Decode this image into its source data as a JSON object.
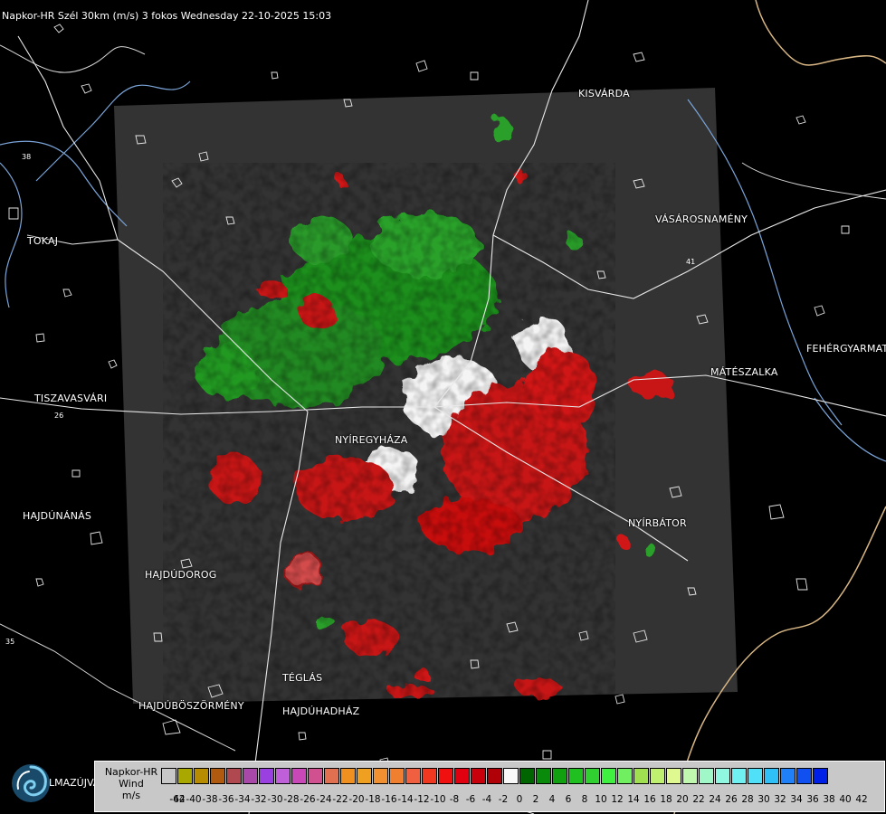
{
  "title": "Napkor-HR Szél 30km (m/s) 3 fokos Wednesday 22-10-2025 15:03",
  "cities": [
    {
      "name": "KISVÁRDA"
    },
    {
      "name": "VÁSÁROSNAMÉNY"
    },
    {
      "name": "TOKAJ"
    },
    {
      "name": "FEHÉRGYARMAT"
    },
    {
      "name": "MÁTÉSZALKA"
    },
    {
      "name": "TISZAVASVÁRI"
    },
    {
      "name": "NYÍREGYHÁZA"
    },
    {
      "name": "NYÍRBÁTOR"
    },
    {
      "name": "HAJDÚNÁNÁS"
    },
    {
      "name": "HAJDÚDOROG"
    },
    {
      "name": "TÉGLÁS"
    },
    {
      "name": "HAJDÚBÖSZÖRMÉNY"
    },
    {
      "name": "HAJDÚHADHÁZ"
    }
  ],
  "road_labels": [
    "38",
    "35",
    "26",
    "41"
  ],
  "logo": {
    "icon": "swirl-icon",
    "text": "LMAZÚJVÁR"
  },
  "legend": {
    "line1": "Napkor-HR",
    "line2": "Wind",
    "line3": "m/s",
    "ticks": [
      "-64",
      "-42",
      "-40",
      "-38",
      "-36",
      "-34",
      "-32",
      "-30",
      "-28",
      "-26",
      "-24",
      "-22",
      "-20",
      "-18",
      "-16",
      "-14",
      "-12",
      "-10",
      "-8",
      "-6",
      "-4",
      "-2",
      "0",
      "2",
      "4",
      "6",
      "8",
      "10",
      "12",
      "14",
      "16",
      "18",
      "20",
      "22",
      "24",
      "26",
      "28",
      "30",
      "32",
      "34",
      "36",
      "38",
      "40",
      "42"
    ],
    "colors": [
      "#c8c8c8",
      "#a8a800",
      "#b88c00",
      "#b05a10",
      "#b04850",
      "#a848a8",
      "#9a40e0",
      "#c060d8",
      "#c848b8",
      "#d05090",
      "#e07050",
      "#f09020",
      "#f0a020",
      "#f09030",
      "#f08030",
      "#f06040",
      "#f03820",
      "#f01010",
      "#e00010",
      "#c8000c",
      "#b00008",
      "#f8f8f8",
      "#006400",
      "#0a8a0a",
      "#10a010",
      "#20c020",
      "#30d030",
      "#40f040",
      "#70f060",
      "#a0e050",
      "#c0f070",
      "#e0f890",
      "#c0f8b0",
      "#a0f8c8",
      "#90f8e0",
      "#70f0f0",
      "#50e0f8",
      "#30c0f8",
      "#2080f8",
      "#1050f0",
      "#0020e8"
    ]
  }
}
